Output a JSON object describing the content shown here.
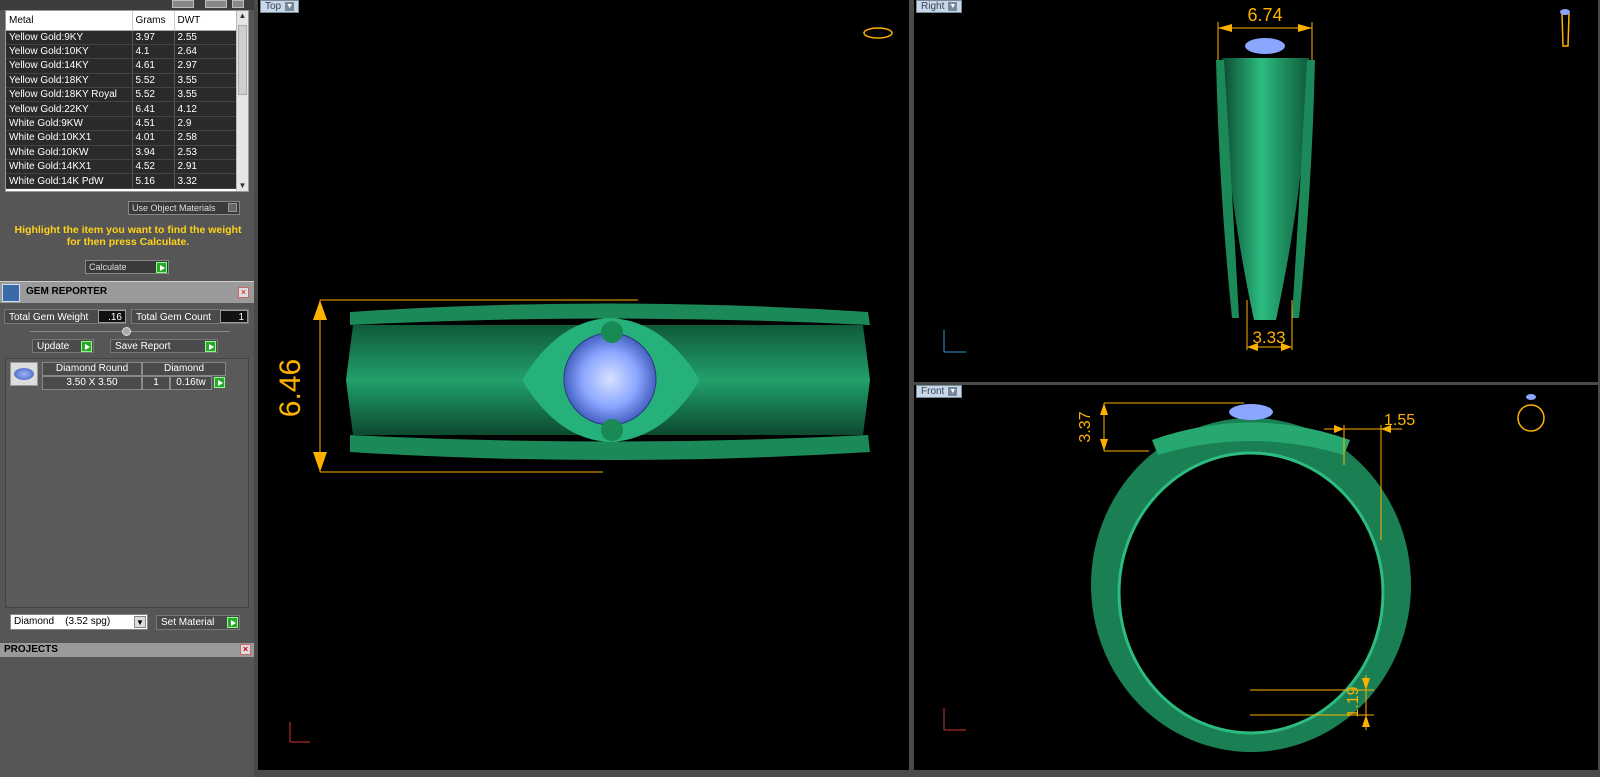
{
  "metals": {
    "headers": [
      "Metal",
      "Grams",
      "DWT"
    ],
    "rows": [
      [
        "Yellow Gold:9KY",
        "3.97",
        "2.55"
      ],
      [
        "Yellow Gold:10KY",
        "4.1",
        "2.64"
      ],
      [
        "Yellow Gold:14KY",
        "4.61",
        "2.97"
      ],
      [
        "Yellow Gold:18KY",
        "5.52",
        "3.55"
      ],
      [
        "Yellow Gold:18KY Royal",
        "5.52",
        "3.55"
      ],
      [
        "Yellow Gold:22KY",
        "6.41",
        "4.12"
      ],
      [
        "White Gold:9KW",
        "4.51",
        "2.9"
      ],
      [
        "White Gold:10KX1",
        "4.01",
        "2.58"
      ],
      [
        "White Gold:10KW",
        "3.94",
        "2.53"
      ],
      [
        "White Gold:14KX1",
        "4.52",
        "2.91"
      ],
      [
        "White Gold:14K PdW",
        "5.16",
        "3.32"
      ]
    ],
    "use_object_materials": "Use Object Materials",
    "hint": "Highlight the item you want to find the weight for then press Calculate.",
    "calculate": "Calculate"
  },
  "gem_reporter": {
    "title": "GEM REPORTER",
    "total_weight_label": "Total Gem Weight",
    "total_weight_value": ".16",
    "total_count_label": "Total Gem Count",
    "total_count_value": "1",
    "update": "Update",
    "save_report": "Save Report",
    "gem": {
      "name": "Diamond Round",
      "size": "3.50 X 3.50",
      "type": "Diamond",
      "count": "1",
      "weight": "0.16tw"
    },
    "material_select": "Diamond    (3.52 spg)",
    "set_material": "Set Material"
  },
  "projects": {
    "title": "PROJECTS"
  },
  "viewports": {
    "top": {
      "label": "Top",
      "dim": "6.46"
    },
    "right": {
      "label": "Right",
      "dim_top": "6.74",
      "dim_bottom": "3.33"
    },
    "front": {
      "label": "Front",
      "dim_a": "3.37",
      "dim_b": "1.55",
      "dim_c": "1.19"
    }
  },
  "colors": {
    "ring": "#1f8a5a",
    "dim": "#ffb100",
    "gem": "#8aa6ff"
  }
}
